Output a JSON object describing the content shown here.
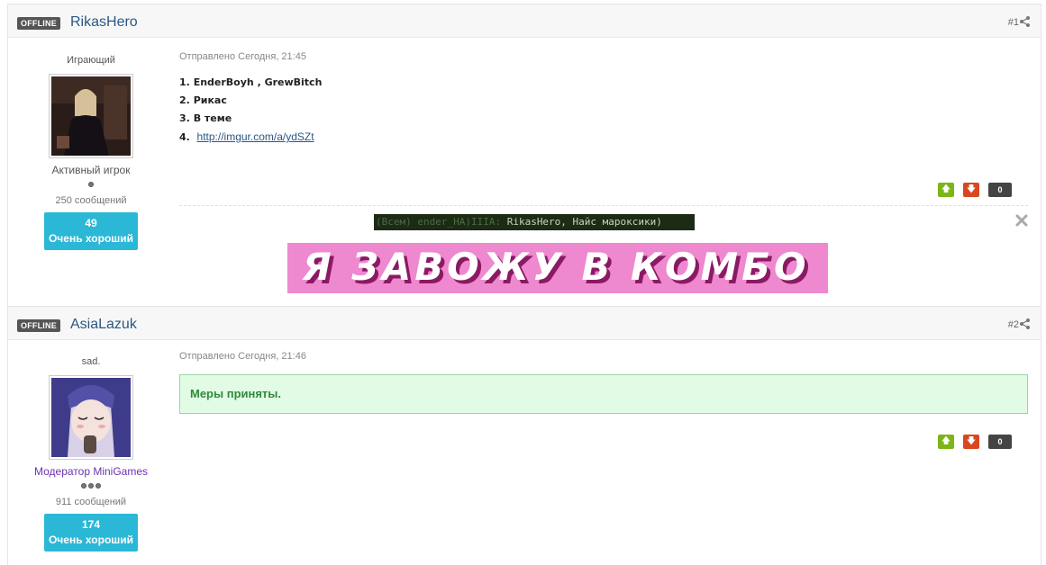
{
  "posts": [
    {
      "status": "OFFLINE",
      "author": "RikasHero",
      "number": "#1",
      "user_title": "Играющий",
      "group": "Активный игрок",
      "post_count": "250 сообщений",
      "reputation": {
        "value": "49",
        "label": "Очень хороший"
      },
      "date": "Отправлено Сегодня, 21:45",
      "body_lines": [
        {
          "num": "1.",
          "text": "EnderBoyh , GrewBitch"
        },
        {
          "num": "2.",
          "text": "Рикас"
        },
        {
          "num": "3.",
          "text": "В теме"
        },
        {
          "num": "4.",
          "link": "http://imgur.com/a/ydSZt"
        }
      ],
      "votes": {
        "up_icon": "arrow-up-icon",
        "down_icon": "arrow-down-icon",
        "count": "0"
      },
      "signature": {
        "chat_prefix": "(Всем) ender_HA)IIIA:",
        "chat_message": " RikasHero, Найс мароксики)",
        "banner_text": "Я ЗАВОЖУ В КОМБО",
        "banner_color": "#ee88cf",
        "banner_text_color": "#ffffff",
        "banner_shadow_color": "#8a1a63"
      }
    },
    {
      "status": "OFFLINE",
      "author": "AsiaLazuk",
      "number": "#2",
      "user_title": "sad.",
      "group": "Модератор MiniGames",
      "post_count": "911 сообщений",
      "reputation": {
        "value": "174",
        "label": "Очень хороший"
      },
      "date": "Отправлено Сегодня, 21:46",
      "message": "Меры приняты.",
      "votes": {
        "up_icon": "arrow-up-icon",
        "down_icon": "arrow-down-icon",
        "count": "0"
      }
    }
  ],
  "colors": {
    "accent_link": "#2a5785",
    "reputation_bg": "#2bb8d6",
    "vote_up": "#7cb518",
    "vote_down": "#d9471e",
    "success_bg": "#e2fbe4",
    "moderator": "#6a33b0"
  }
}
